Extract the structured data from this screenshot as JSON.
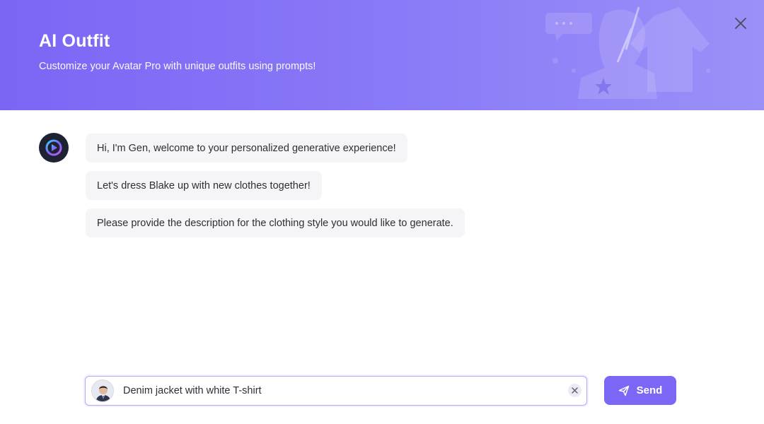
{
  "header": {
    "title": "AI Outfit",
    "subtitle": "Customize your Avatar Pro with unique outfits using prompts!"
  },
  "chat": {
    "messages": [
      {
        "text": "Hi, I'm Gen, welcome to your personalized generative experience!"
      },
      {
        "text": "Let's dress Blake up with new clothes together!"
      },
      {
        "text": "Please provide the description for the clothing style you would like to generate."
      }
    ]
  },
  "composer": {
    "prompt_value": "Denim jacket with white T-shirt",
    "send_label": "Send"
  },
  "icons": {
    "close": "close-icon",
    "bot": "gen-logo-icon",
    "clear": "clear-icon",
    "send": "send-icon"
  },
  "colors": {
    "accent": "#7b67f5",
    "header_gradient_start": "#7a66f5",
    "header_gradient_end": "#9b90f8",
    "bubble_bg": "#f5f5f7"
  }
}
